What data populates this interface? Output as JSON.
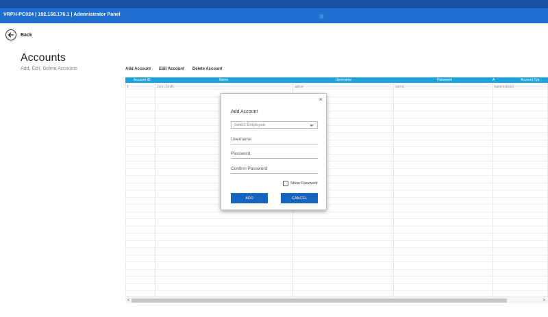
{
  "window": {
    "title": "VRPH-PC024 | 192.168.176.1 | Administrator Panel"
  },
  "nav": {
    "back_label": "Back"
  },
  "page": {
    "title": "Accounts",
    "subtitle": "Add, Edit, Delete Accounts"
  },
  "toolbar": {
    "items": [
      "Add Account",
      "Edit Account",
      "Delete Account"
    ]
  },
  "table": {
    "columns": [
      "Account ID",
      "Name",
      "Username",
      "Password",
      "A",
      "Account Typ"
    ],
    "rows": [
      [
        "1",
        "John Smith",
        "admin",
        "admin",
        "Administrator"
      ]
    ]
  },
  "dialog": {
    "title": "Add Account",
    "close_symbol": "×",
    "employee_placeholder": "Select Employee",
    "username_placeholder": "Username",
    "password_placeholder": "Password",
    "confirm_placeholder": "Confirm Password",
    "show_password_label": "Show Password",
    "add_label": "ADD",
    "cancel_label": "CANCEL"
  },
  "scroll": {
    "left_arrow": "<",
    "right_arrow": ">"
  },
  "colors": {
    "titlebar": "#1e6fd0",
    "topbar": "#1b4fa3",
    "grid_header": "#1ea3e1",
    "button": "#1565c0"
  }
}
